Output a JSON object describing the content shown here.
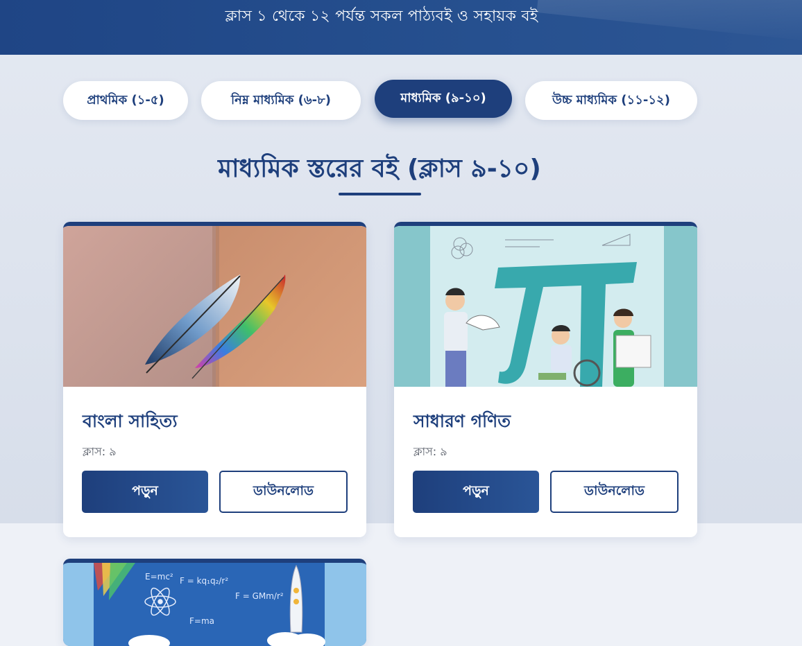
{
  "header": {
    "subtitle": "ক্লাস ১ থেকে ১২ পর্যন্ত সকল পাঠ্যবই ও সহায়ক বই"
  },
  "tabs": [
    {
      "label": "প্রাথমিক (১-৫)",
      "active": false
    },
    {
      "label": "নিম্ন মাধ্যমিক (৬-৮)",
      "active": false
    },
    {
      "label": "মাধ্যমিক (৯-১০)",
      "active": true
    },
    {
      "label": "উচ্চ মাধ্যমিক (১১-১২)",
      "active": false
    }
  ],
  "section": {
    "title": "মাধ্যমিক স্তরের বই (ক্লাস ৯-১০)"
  },
  "books": [
    {
      "title": "বাংলা সাহিত্য",
      "class_label": "ক্লাস: ৯",
      "read_label": "পড়ুন",
      "download_label": "ডাউনলোড",
      "cover": "feather-quills-cover"
    },
    {
      "title": "সাধারণ গণিত",
      "class_label": "ক্লাস: ৯",
      "read_label": "পড়ুন",
      "download_label": "ডাউনলোড",
      "cover": "pi-math-cover"
    },
    {
      "cover": "science-rocket-cover",
      "cover_formulas": [
        "E=mc²",
        "F=ma",
        "F = GMm/r²",
        "F = kq₁q₂/r²"
      ]
    }
  ],
  "colors": {
    "primary": "#1e3f7c",
    "header_bg": "#26508f",
    "page_bg": "#e4e9f2"
  }
}
